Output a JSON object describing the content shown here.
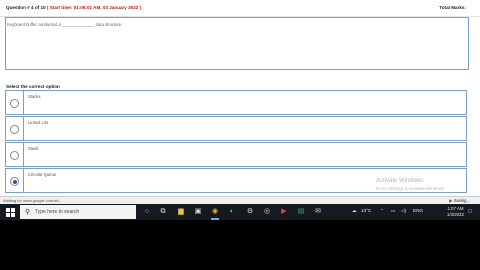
{
  "header": {
    "question_number": "Question # 4 of 10",
    "start_time": "( Start time: 01:06:01 AM, 03 January 2022 )",
    "total_marks": "Total Marks:"
  },
  "question": {
    "text": "Keyboard buffer conducted a ______________ data structure."
  },
  "select_label": "Select the correct option",
  "options": [
    {
      "label": "Stacks",
      "selected": false
    },
    {
      "label": "Linked List",
      "selected": false
    },
    {
      "label": "Stack",
      "selected": false
    },
    {
      "label": "Circular Queue",
      "selected": true
    }
  ],
  "watermark": {
    "line1": "Activate Windows",
    "line2": "Go to Settings to activate Windows."
  },
  "status_bar": {
    "left_text": "Waiting for www.google.com/sb...",
    "saving_label": "Saving..."
  },
  "taskbar": {
    "search_placeholder": "Type here to search",
    "search_icon": "search-icon",
    "apps": [
      "cortana-icon",
      "task-view-icon",
      "file-explorer-icon",
      "store-icon",
      "chrome-icon",
      "edge-icon",
      "settings-icon",
      "steam-icon",
      "media-icon",
      "photos-icon",
      "mail-icon"
    ],
    "temperature": "13°C",
    "language": "ENG",
    "time": "1:07 AM",
    "date": "1/3/2022"
  }
}
